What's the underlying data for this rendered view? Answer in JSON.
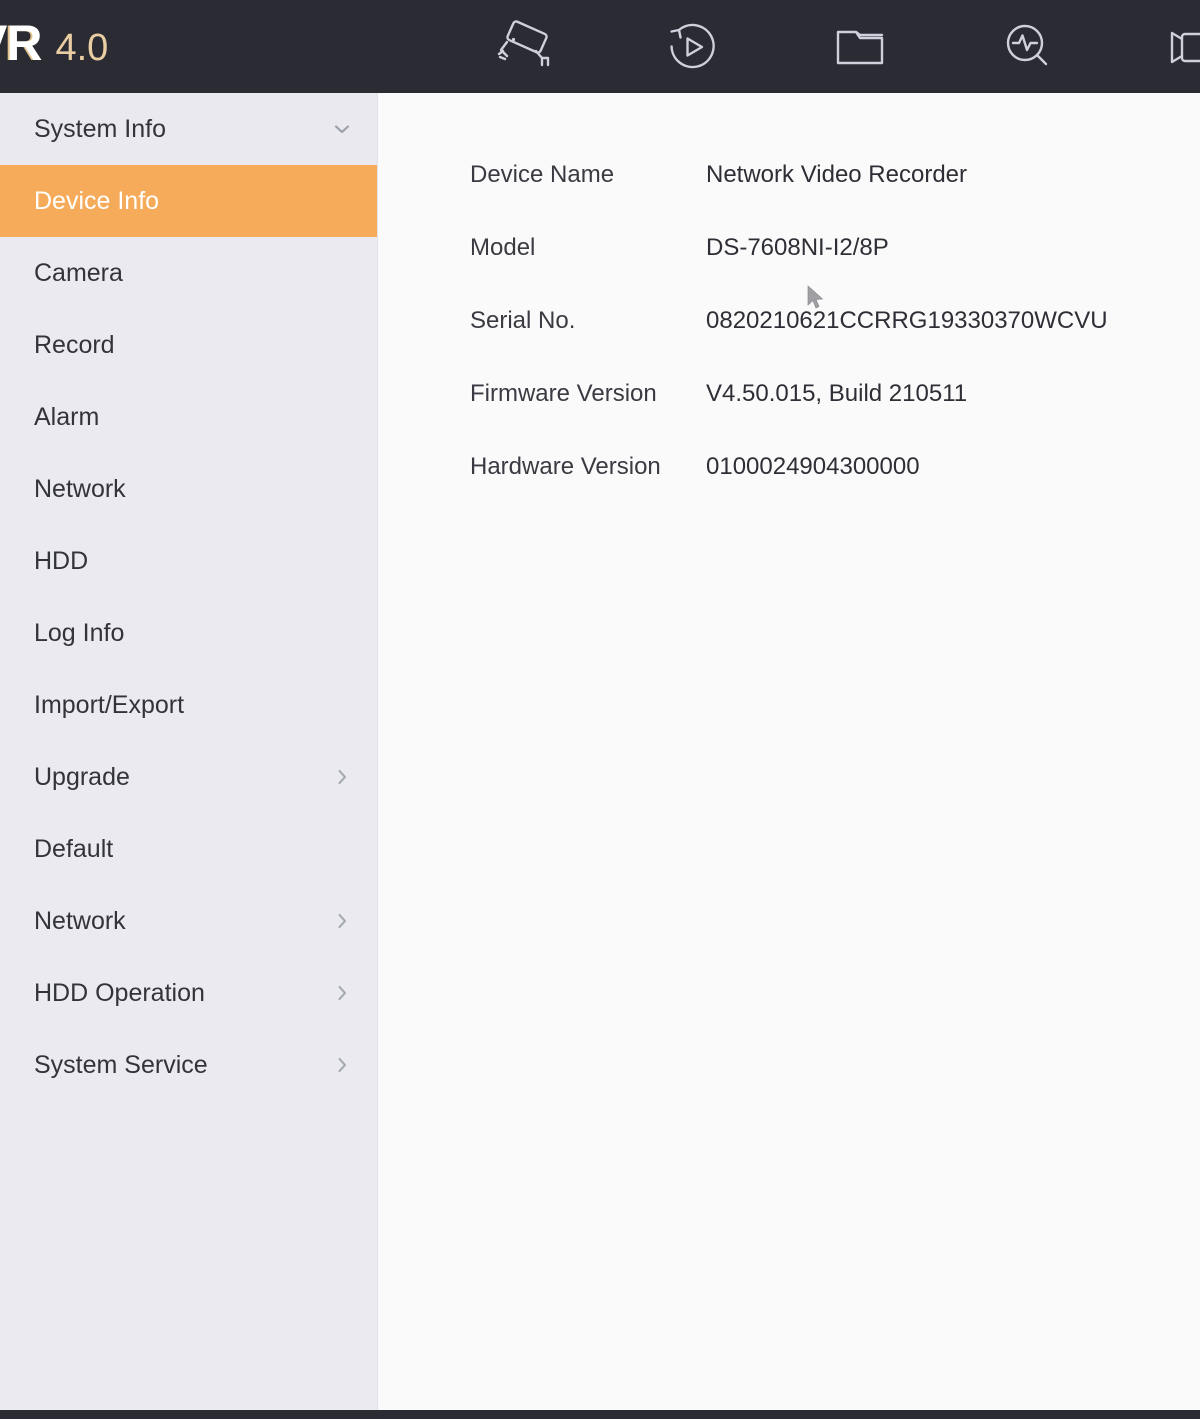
{
  "header": {
    "logo_main": "VR",
    "logo_version": "4.0",
    "brand_color": "#e9cda3",
    "background": "#2b2b33",
    "nav": [
      {
        "name": "live-view",
        "icon": "security-camera-icon",
        "label": "Live View"
      },
      {
        "name": "playback",
        "icon": "playback-replay-icon",
        "label": "Playback"
      },
      {
        "name": "file-management",
        "icon": "folder-icon",
        "label": "File"
      },
      {
        "name": "smart-search",
        "icon": "magnifier-waveform-icon",
        "label": "Smart Analysis"
      },
      {
        "name": "camcorder",
        "icon": "camcorder-icon",
        "label": "Camera"
      }
    ]
  },
  "sidebar": {
    "background": "#eaeaf0",
    "active_color": "#f5ab5a",
    "header": {
      "label": "System Info",
      "icon": "chevron-down-icon"
    },
    "items": [
      {
        "label": "Device Info",
        "active": true,
        "chevron": false
      },
      {
        "label": "Camera",
        "active": false,
        "chevron": false
      },
      {
        "label": "Record",
        "active": false,
        "chevron": false
      },
      {
        "label": "Alarm",
        "active": false,
        "chevron": false
      },
      {
        "label": "Network",
        "active": false,
        "chevron": false
      },
      {
        "label": "HDD",
        "active": false,
        "chevron": false
      },
      {
        "label": "Log Info",
        "active": false,
        "chevron": false
      },
      {
        "label": "Import/Export",
        "active": false,
        "chevron": false
      },
      {
        "label": "Upgrade",
        "active": false,
        "chevron": true
      },
      {
        "label": "Default",
        "active": false,
        "chevron": false
      },
      {
        "label": "Network",
        "active": false,
        "chevron": true
      },
      {
        "label": "HDD Operation",
        "active": false,
        "chevron": true
      },
      {
        "label": "System Service",
        "active": false,
        "chevron": true
      }
    ]
  },
  "main": {
    "background": "#fafafa",
    "device_info": [
      {
        "label": "Device Name",
        "value": "Network Video Recorder"
      },
      {
        "label": "Model",
        "value": "DS-7608NI-I2/8P"
      },
      {
        "label": "Serial No.",
        "value": "0820210621CCRRG19330370WCVU"
      },
      {
        "label": "Firmware Version",
        "value": "V4.50.015, Build 210511"
      },
      {
        "label": "Hardware Version",
        "value": "0100024904300000"
      }
    ]
  }
}
